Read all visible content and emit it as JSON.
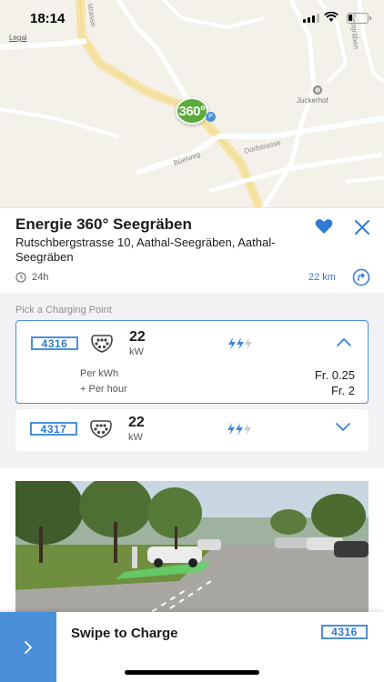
{
  "status_bar": {
    "time": "18:14"
  },
  "map": {
    "legal_label": "Legal",
    "pin_label": "360°",
    "pin_badge": "P",
    "place_label": "Juckerhof",
    "streets": [
      "Dorfstrasse",
      "Büelweg",
      "strasse",
      "Seegräben"
    ]
  },
  "station": {
    "name": "Energie 360° Seegräben",
    "address": "Rutschbergstrasse 10, Aathal-Seegräben, Aathal-Seegräben",
    "hours": "24h",
    "distance": "22 km",
    "favorite": true,
    "accent_color": "#2f7bd3"
  },
  "charging": {
    "section_label": "Pick a Charging Point",
    "points": [
      {
        "id": "4316",
        "power": "22",
        "unit": "kW",
        "expanded": true,
        "prices": [
          {
            "label": "Per kWh",
            "value": "Fr. 0.25"
          },
          {
            "label": "+  Per hour",
            "value": "Fr. 2"
          }
        ]
      },
      {
        "id": "4317",
        "power": "22",
        "unit": "kW",
        "expanded": false
      }
    ]
  },
  "swipe": {
    "label": "Swipe to Charge",
    "point_id": "4316"
  },
  "icons": [
    "clock-icon",
    "heart-icon",
    "close-icon",
    "route-icon",
    "plug-type2-icon",
    "bolt-icon",
    "chevron-up-icon",
    "chevron-down-icon",
    "chevron-right-icon"
  ]
}
